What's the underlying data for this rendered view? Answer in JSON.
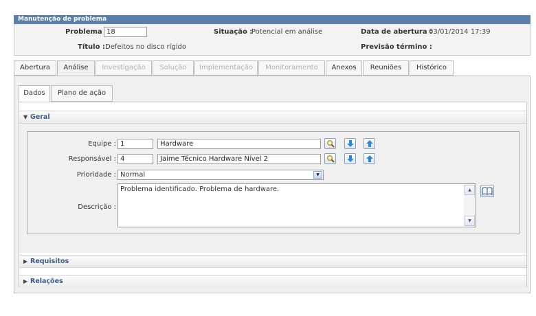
{
  "header": {
    "title": "Manutenção de problema",
    "problema_label": "Problema :",
    "problema_value": "18",
    "situacao_label": "Situação :",
    "situacao_value": "Potencial em análise",
    "data_abertura_label": "Data de abertura :",
    "data_abertura_value": "03/01/2014 17:39",
    "titulo_label": "Título :",
    "titulo_value": "Defeitos no disco rígido",
    "previsao_label": "Previsão término :",
    "previsao_value": ""
  },
  "tabs": [
    {
      "label": "Abertura",
      "enabled": true
    },
    {
      "label": "Análise",
      "enabled": true,
      "active": true
    },
    {
      "label": "Investigação",
      "enabled": false
    },
    {
      "label": "Solução",
      "enabled": false
    },
    {
      "label": "Implementação",
      "enabled": false
    },
    {
      "label": "Monitoramento",
      "enabled": false
    },
    {
      "label": "Anexos",
      "enabled": true
    },
    {
      "label": "Reuniões",
      "enabled": true
    },
    {
      "label": "Histórico",
      "enabled": true
    }
  ],
  "subtabs": [
    {
      "label": "Dados",
      "active": true
    },
    {
      "label": "Plano de ação"
    }
  ],
  "geral": {
    "section_label": "Geral",
    "equipe_label": "Equipe :",
    "equipe_code": "1",
    "equipe_name": "Hardware",
    "responsavel_label": "Responsável :",
    "responsavel_code": "4",
    "responsavel_name": "Jaime Técnico Hardware Nível 2",
    "prioridade_label": "Prioridade :",
    "prioridade_value": "Normal",
    "descricao_label": "Descrição :",
    "descricao_value": "Problema identificado. Problema de hardware."
  },
  "sections": {
    "requisitos": "Requisitos",
    "relacoes": "Relações"
  },
  "icons": {
    "search": "search-icon",
    "move_down": "arrow-down-icon",
    "move_up": "arrow-up-icon",
    "dictionary": "book-icon"
  },
  "colors": {
    "title_bar": "#5b7fa8",
    "section_text": "#3b5a86",
    "arrow_blue": "#2f86d6"
  }
}
